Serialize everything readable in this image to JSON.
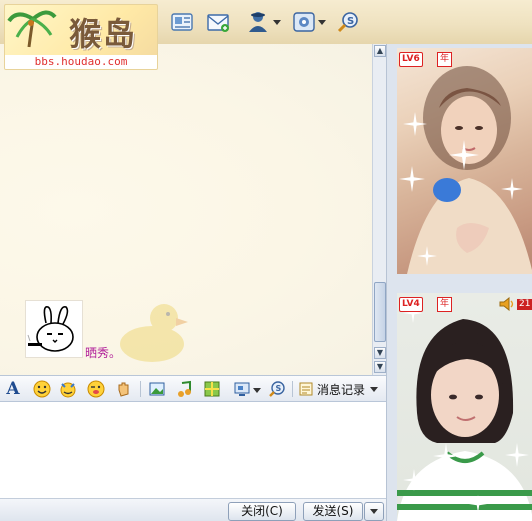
{
  "logo": {
    "text": "猴岛",
    "url": "bbs.houdao.com"
  },
  "toolbar": {
    "icons": [
      "user-card-icon",
      "mail-icon",
      "add-friend-icon",
      "user-menu-icon",
      "settings-icon",
      "search-bubble-icon"
    ]
  },
  "chat": {
    "emote_caption": "晒秀。"
  },
  "format_toolbar": {
    "font_label": "A",
    "history_label": "消息记录"
  },
  "actions": {
    "close_label": "关闭(C)",
    "send_label": "发送(S)"
  },
  "peer": {
    "level_label": "LV6",
    "year_badge": "年"
  },
  "self": {
    "level_label": "LV4",
    "year_badge": "年",
    "volume_value": "21"
  }
}
